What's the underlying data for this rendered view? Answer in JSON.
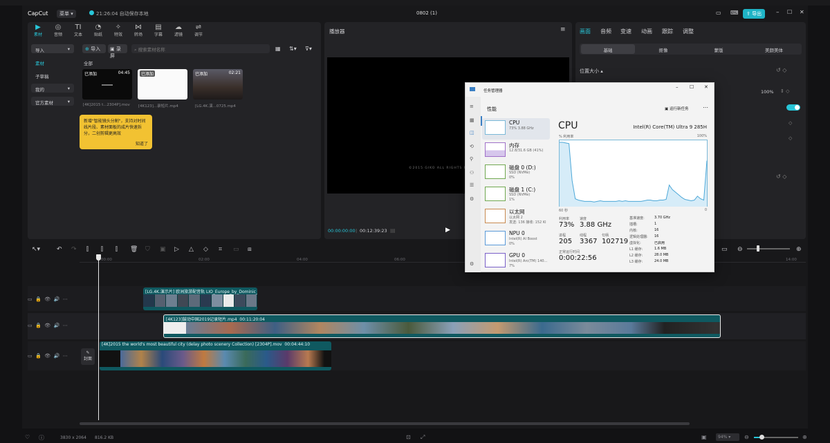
{
  "app": {
    "name": "CapCut",
    "menu": "菜单",
    "save_status": "21:26:04 自动保存本地",
    "project_title": "0802 (1)",
    "export": "导出"
  },
  "media_tabs": [
    "素材",
    "音频",
    "文本",
    "贴纸",
    "特效",
    "转场",
    "字幕",
    "滤镜",
    "调节"
  ],
  "left_nav": {
    "import": "导入",
    "materials": "素材",
    "sub_draft": "子草稿",
    "mine": "我的",
    "official": "官方素材"
  },
  "media_toolbar": {
    "import": "导入",
    "record": "录屏",
    "search_placeholder": "搜索素材名称",
    "section": "全部"
  },
  "media_items": [
    {
      "tag": "已添加",
      "duration": "04:45",
      "caption": "[4K]2015 t...2304P].mov"
    },
    {
      "tag": "已添加",
      "duration": "",
      "caption": "[4K123]...录短片.mp4"
    },
    {
      "tag": "已添加",
      "duration": "02:21",
      "caption": "[LG.4K.演...0725.mp4"
    }
  ],
  "tip": {
    "text": "新增\"智能镜头分割\"，支持对时间线片段、素材面板的成片快速拆分，二创剪辑更高效",
    "ok": "知道了"
  },
  "player": {
    "title": "播放器",
    "current": "00:00:00:00",
    "total": "00:12:39:23",
    "watermark": "©2015 GIKO ALL RIGHTS RESERVED"
  },
  "right_panel": {
    "tabs": [
      "画面",
      "音频",
      "变速",
      "动画",
      "跟踪",
      "调整"
    ],
    "subtabs": [
      "基础",
      "抠像",
      "蒙版",
      "美颜美体"
    ],
    "section": "位置大小",
    "scale": "100%"
  },
  "timeline": {
    "ruler": [
      "00:00",
      "02:00",
      "04:00",
      "06:00",
      "14:00"
    ],
    "clips": [
      {
        "label": "[LG.4K.演示片] 欧洲旅游配音轨 LIO_Europe_by_Dominic_0725.mp4"
      },
      {
        "label": "[4K123]鼓动中国2019记录短片.mp4",
        "duration": "00:11:20:04"
      },
      {
        "label": "[4K]2015 the world's most beautiful city (delay photo scenery Collection) [2304P].mov",
        "duration": "00:04:44:10"
      }
    ],
    "cover": "封面",
    "zoom": "94%"
  },
  "status": {
    "resolution": "3830 x 2064",
    "size": "816.2 KB"
  },
  "task_manager": {
    "title": "任务管理器",
    "section": "性能",
    "run_task": "运行新任务",
    "heading": "CPU",
    "cpu_name": "Intel(R) Core(TM) Ultra 9 285H",
    "util_label": "% 利用率",
    "hundred": "100%",
    "seconds": "60 秒",
    "zero": "0",
    "items": [
      {
        "name": "CPU",
        "l1": "73% 3.88 GHz",
        "l2": ""
      },
      {
        "name": "内存",
        "l1": "12.8/31.6 GB (41%)",
        "l2": ""
      },
      {
        "name": "磁盘 0 (D:)",
        "l1": "SSD (NVMe)",
        "l2": "0%"
      },
      {
        "name": "磁盘 1 (C:)",
        "l1": "SSD (NVMe)",
        "l2": "1%"
      },
      {
        "name": "以太网",
        "l1": "以太网 2",
        "l2": "发送: 136 接收: 152 Kl"
      },
      {
        "name": "NPU 0",
        "l1": "Intel(R) AI Boost",
        "l2": "0%"
      },
      {
        "name": "GPU 0",
        "l1": "Intel(R) Arc(TM) 140...",
        "l2": "7%"
      }
    ],
    "stats": {
      "util_label": "利用率",
      "util": "73%",
      "speed_label": "速度",
      "speed": "3.88 GHz",
      "proc_label": "进程",
      "proc": "205",
      "thread_label": "线程",
      "thread": "3367",
      "handle_label": "句柄",
      "handle": "102719",
      "uptime_label": "正常运行时间",
      "uptime": "0:00:22:56"
    },
    "specs": [
      [
        "基准速度:",
        "3.70 GHz"
      ],
      [
        "插槽:",
        "1"
      ],
      [
        "内核:",
        "16"
      ],
      [
        "逻辑处理器:",
        "16"
      ],
      [
        "虚拟化:",
        "已启用"
      ],
      [
        "L1 缓存:",
        "1.6 MB"
      ],
      [
        "L2 缓存:",
        "28.0 MB"
      ],
      [
        "L3 缓存:",
        "24.0 MB"
      ]
    ],
    "cpu_series": [
      98,
      98,
      97,
      96,
      40,
      12,
      10,
      9,
      8,
      8,
      8,
      7,
      8,
      9,
      8,
      8,
      8,
      8,
      8,
      9,
      8,
      9,
      8,
      8,
      8,
      8,
      8,
      9,
      10,
      10,
      9,
      9,
      10,
      10,
      11,
      33,
      26,
      22,
      18,
      14,
      11,
      10,
      9,
      10,
      16,
      12,
      10,
      70
    ]
  },
  "colors": {
    "accent": "#28c6d8",
    "export": "#1fb4c6",
    "graph": "#4da8d8"
  }
}
